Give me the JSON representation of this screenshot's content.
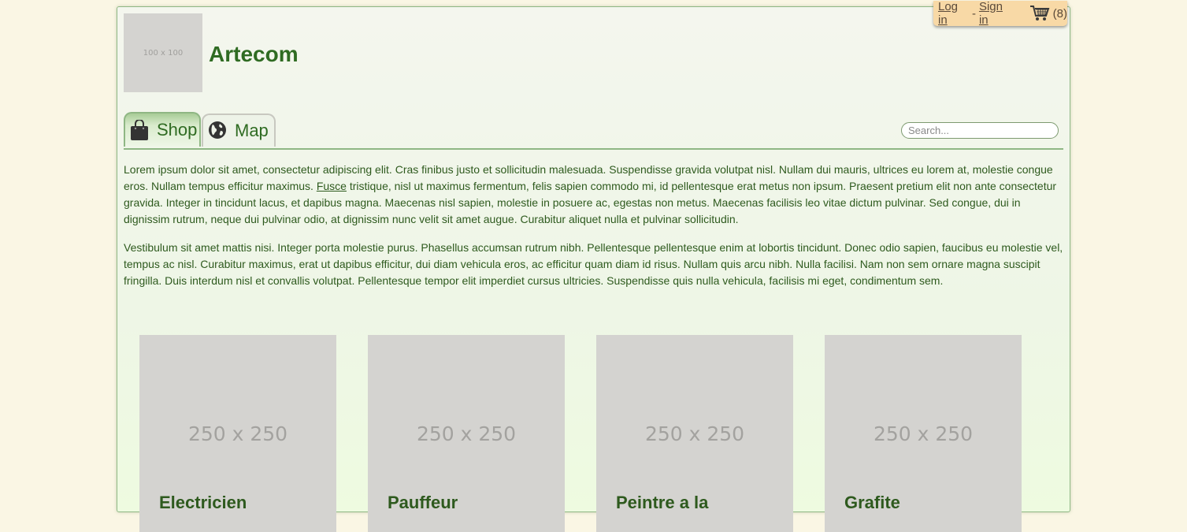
{
  "header": {
    "logo_placeholder": "100 x 100",
    "site_title": "Artecom"
  },
  "userbox": {
    "login_label": "Log in",
    "separator": "-",
    "signin_label": "Sign in",
    "cart_count": "(8)"
  },
  "tabs": [
    {
      "label": "Shop",
      "icon": "shopping-bag-icon",
      "active": true
    },
    {
      "label": "Map",
      "icon": "globe-icon",
      "active": false
    }
  ],
  "search": {
    "placeholder": "Search..."
  },
  "content": {
    "p1_before_link": "Lorem ipsum dolor sit amet, consectetur adipiscing elit. Cras finibus justo et sollicitudin malesuada. Suspendisse gravida volutpat nisl. Nullam dui mauris, ultrices eu lorem at, molestie congue eros. Nullam tempus efficitur maximus. ",
    "p1_link": "Fusce",
    "p1_after_link": " tristique, nisl ut maximus fermentum, felis sapien commodo mi, id pellentesque erat metus non ipsum. Praesent pretium elit non ante consectetur gravida. Integer in tincidunt lacus, et dapibus magna. Maecenas nisl sapien, molestie in posuere ac, egestas non metus. Maecenas facilisis leo vitae dictum pulvinar. Sed congue, dui in dignissim rutrum, neque dui pulvinar odio, at dignissim nunc velit sit amet augue. Curabitur aliquet nulla et pulvinar sollicitudin.",
    "p2": "Vestibulum sit amet mattis nisi. Integer porta molestie purus. Phasellus accumsan rutrum nibh. Pellentesque pellentesque enim at lobortis tincidunt. Donec odio sapien, faucibus eu molestie vel, tempus ac nisl. Curabitur maximus, erat ut dapibus efficitur, dui diam vehicula eros, ac efficitur quam diam id risus. Nullam quis arcu nibh. Nulla facilisi. Nam non sem ornare magna suscipit fringilla. Duis interdum nisl et convallis volutpat. Pellentesque tempor elit imperdiet cursus ultricies. Suspendisse quis nulla vehicula, facilisis mi eget, condimentum sem."
  },
  "products": [
    {
      "image_placeholder": "250 x 250",
      "name": "Electricien"
    },
    {
      "image_placeholder": "250 x 250",
      "name": "Pauffeur"
    },
    {
      "image_placeholder": "250 x 250",
      "name": "Peintre a la"
    },
    {
      "image_placeholder": "250 x 250",
      "name": "Grafite"
    }
  ],
  "colors": {
    "background": "#faf6e4",
    "accent_green": "#2f6b22",
    "userbox": "#f8d9a6"
  }
}
